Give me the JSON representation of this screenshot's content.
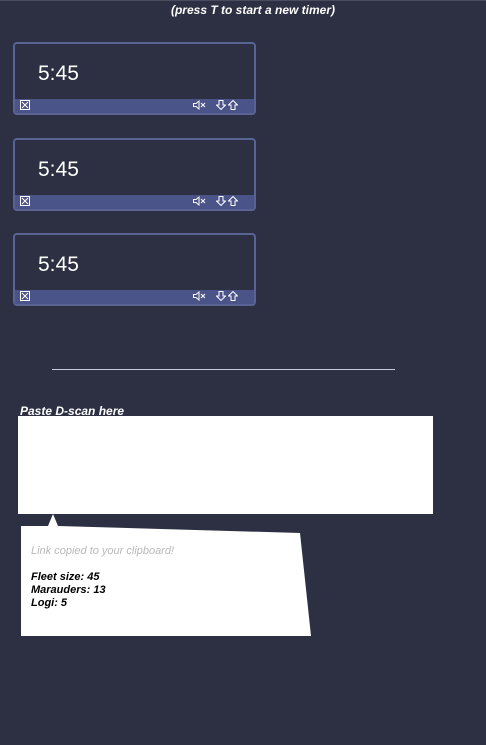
{
  "hint": "(press T to start a new timer)",
  "timers": [
    {
      "time": "5:45"
    },
    {
      "time": "5:45"
    },
    {
      "time": "5:45"
    }
  ],
  "icons": {
    "close": "close-box-icon",
    "mute": "speaker-muted-icon",
    "down": "arrow-down-icon",
    "up": "arrow-up-icon"
  },
  "dscan": {
    "label": "Paste D-scan here",
    "value": ""
  },
  "result": {
    "message": "Link copied to your clipboard!",
    "stats": [
      {
        "text": "Fleet size: 45"
      },
      {
        "text": "Marauders: 13"
      },
      {
        "text": "Logi: 5"
      }
    ]
  },
  "colors": {
    "background": "#2d3042",
    "timer_border": "#5a6494",
    "timer_bar": "#4a5488"
  }
}
